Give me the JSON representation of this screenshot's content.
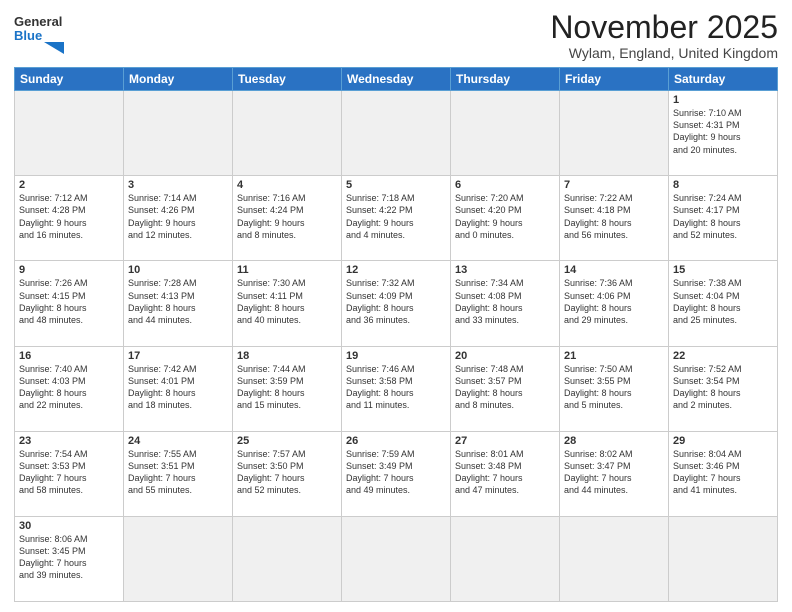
{
  "header": {
    "logo_general": "General",
    "logo_blue": "Blue",
    "title": "November 2025",
    "subtitle": "Wylam, England, United Kingdom"
  },
  "days_of_week": [
    "Sunday",
    "Monday",
    "Tuesday",
    "Wednesday",
    "Thursday",
    "Friday",
    "Saturday"
  ],
  "weeks": [
    [
      {
        "day": "",
        "empty": true
      },
      {
        "day": "",
        "empty": true
      },
      {
        "day": "",
        "empty": true
      },
      {
        "day": "",
        "empty": true
      },
      {
        "day": "",
        "empty": true
      },
      {
        "day": "",
        "empty": true
      },
      {
        "day": "1",
        "info": "Sunrise: 7:10 AM\nSunset: 4:31 PM\nDaylight: 9 hours\nand 20 minutes."
      }
    ],
    [
      {
        "day": "2",
        "info": "Sunrise: 7:12 AM\nSunset: 4:28 PM\nDaylight: 9 hours\nand 16 minutes."
      },
      {
        "day": "3",
        "info": "Sunrise: 7:14 AM\nSunset: 4:26 PM\nDaylight: 9 hours\nand 12 minutes."
      },
      {
        "day": "4",
        "info": "Sunrise: 7:16 AM\nSunset: 4:24 PM\nDaylight: 9 hours\nand 8 minutes."
      },
      {
        "day": "5",
        "info": "Sunrise: 7:18 AM\nSunset: 4:22 PM\nDaylight: 9 hours\nand 4 minutes."
      },
      {
        "day": "6",
        "info": "Sunrise: 7:20 AM\nSunset: 4:20 PM\nDaylight: 9 hours\nand 0 minutes."
      },
      {
        "day": "7",
        "info": "Sunrise: 7:22 AM\nSunset: 4:18 PM\nDaylight: 8 hours\nand 56 minutes."
      },
      {
        "day": "8",
        "info": "Sunrise: 7:24 AM\nSunset: 4:17 PM\nDaylight: 8 hours\nand 52 minutes."
      }
    ],
    [
      {
        "day": "9",
        "info": "Sunrise: 7:26 AM\nSunset: 4:15 PM\nDaylight: 8 hours\nand 48 minutes."
      },
      {
        "day": "10",
        "info": "Sunrise: 7:28 AM\nSunset: 4:13 PM\nDaylight: 8 hours\nand 44 minutes."
      },
      {
        "day": "11",
        "info": "Sunrise: 7:30 AM\nSunset: 4:11 PM\nDaylight: 8 hours\nand 40 minutes."
      },
      {
        "day": "12",
        "info": "Sunrise: 7:32 AM\nSunset: 4:09 PM\nDaylight: 8 hours\nand 36 minutes."
      },
      {
        "day": "13",
        "info": "Sunrise: 7:34 AM\nSunset: 4:08 PM\nDaylight: 8 hours\nand 33 minutes."
      },
      {
        "day": "14",
        "info": "Sunrise: 7:36 AM\nSunset: 4:06 PM\nDaylight: 8 hours\nand 29 minutes."
      },
      {
        "day": "15",
        "info": "Sunrise: 7:38 AM\nSunset: 4:04 PM\nDaylight: 8 hours\nand 25 minutes."
      }
    ],
    [
      {
        "day": "16",
        "info": "Sunrise: 7:40 AM\nSunset: 4:03 PM\nDaylight: 8 hours\nand 22 minutes."
      },
      {
        "day": "17",
        "info": "Sunrise: 7:42 AM\nSunset: 4:01 PM\nDaylight: 8 hours\nand 18 minutes."
      },
      {
        "day": "18",
        "info": "Sunrise: 7:44 AM\nSunset: 3:59 PM\nDaylight: 8 hours\nand 15 minutes."
      },
      {
        "day": "19",
        "info": "Sunrise: 7:46 AM\nSunset: 3:58 PM\nDaylight: 8 hours\nand 11 minutes."
      },
      {
        "day": "20",
        "info": "Sunrise: 7:48 AM\nSunset: 3:57 PM\nDaylight: 8 hours\nand 8 minutes."
      },
      {
        "day": "21",
        "info": "Sunrise: 7:50 AM\nSunset: 3:55 PM\nDaylight: 8 hours\nand 5 minutes."
      },
      {
        "day": "22",
        "info": "Sunrise: 7:52 AM\nSunset: 3:54 PM\nDaylight: 8 hours\nand 2 minutes."
      }
    ],
    [
      {
        "day": "23",
        "info": "Sunrise: 7:54 AM\nSunset: 3:53 PM\nDaylight: 7 hours\nand 58 minutes."
      },
      {
        "day": "24",
        "info": "Sunrise: 7:55 AM\nSunset: 3:51 PM\nDaylight: 7 hours\nand 55 minutes."
      },
      {
        "day": "25",
        "info": "Sunrise: 7:57 AM\nSunset: 3:50 PM\nDaylight: 7 hours\nand 52 minutes."
      },
      {
        "day": "26",
        "info": "Sunrise: 7:59 AM\nSunset: 3:49 PM\nDaylight: 7 hours\nand 49 minutes."
      },
      {
        "day": "27",
        "info": "Sunrise: 8:01 AM\nSunset: 3:48 PM\nDaylight: 7 hours\nand 47 minutes."
      },
      {
        "day": "28",
        "info": "Sunrise: 8:02 AM\nSunset: 3:47 PM\nDaylight: 7 hours\nand 44 minutes."
      },
      {
        "day": "29",
        "info": "Sunrise: 8:04 AM\nSunset: 3:46 PM\nDaylight: 7 hours\nand 41 minutes."
      }
    ],
    [
      {
        "day": "30",
        "info": "Sunrise: 8:06 AM\nSunset: 3:45 PM\nDaylight: 7 hours\nand 39 minutes."
      },
      {
        "day": "",
        "empty": true
      },
      {
        "day": "",
        "empty": true
      },
      {
        "day": "",
        "empty": true
      },
      {
        "day": "",
        "empty": true
      },
      {
        "day": "",
        "empty": true
      },
      {
        "day": "",
        "empty": true
      }
    ]
  ]
}
